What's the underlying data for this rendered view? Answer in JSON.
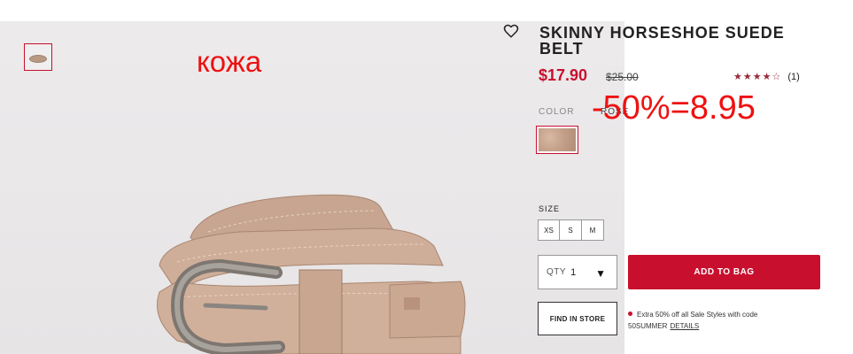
{
  "product": {
    "title": "SKINNY HORSESHOE SUEDE BELT",
    "sale_price": "$17.90",
    "original_price": "$25.00",
    "rating_stars": "★★★★☆",
    "rating_count": "(1)",
    "color_label": "COLOR",
    "color_value": "ROSE",
    "size_label": "SIZE",
    "sizes": [
      "XS",
      "S",
      "M"
    ],
    "qty_label": "QTY",
    "qty_value": "1",
    "add_to_bag": "ADD TO BAG",
    "find_in_store": "FIND IN STORE",
    "promo_text": "Extra 50% off all Sale Styles with code 50SUMMER",
    "promo_link": "DETAILS"
  },
  "annotations": {
    "material_note": "кожа",
    "discount_note": "-50%=8.95"
  },
  "icons": {
    "favorite": "heart-outline-icon",
    "qty_dropdown": "caret-down-icon",
    "promo_bullet": "bullet-dot-icon"
  },
  "colors": {
    "accent": "#c8102e",
    "annotation": "#ee1111",
    "swatch": "#c4a18b"
  }
}
